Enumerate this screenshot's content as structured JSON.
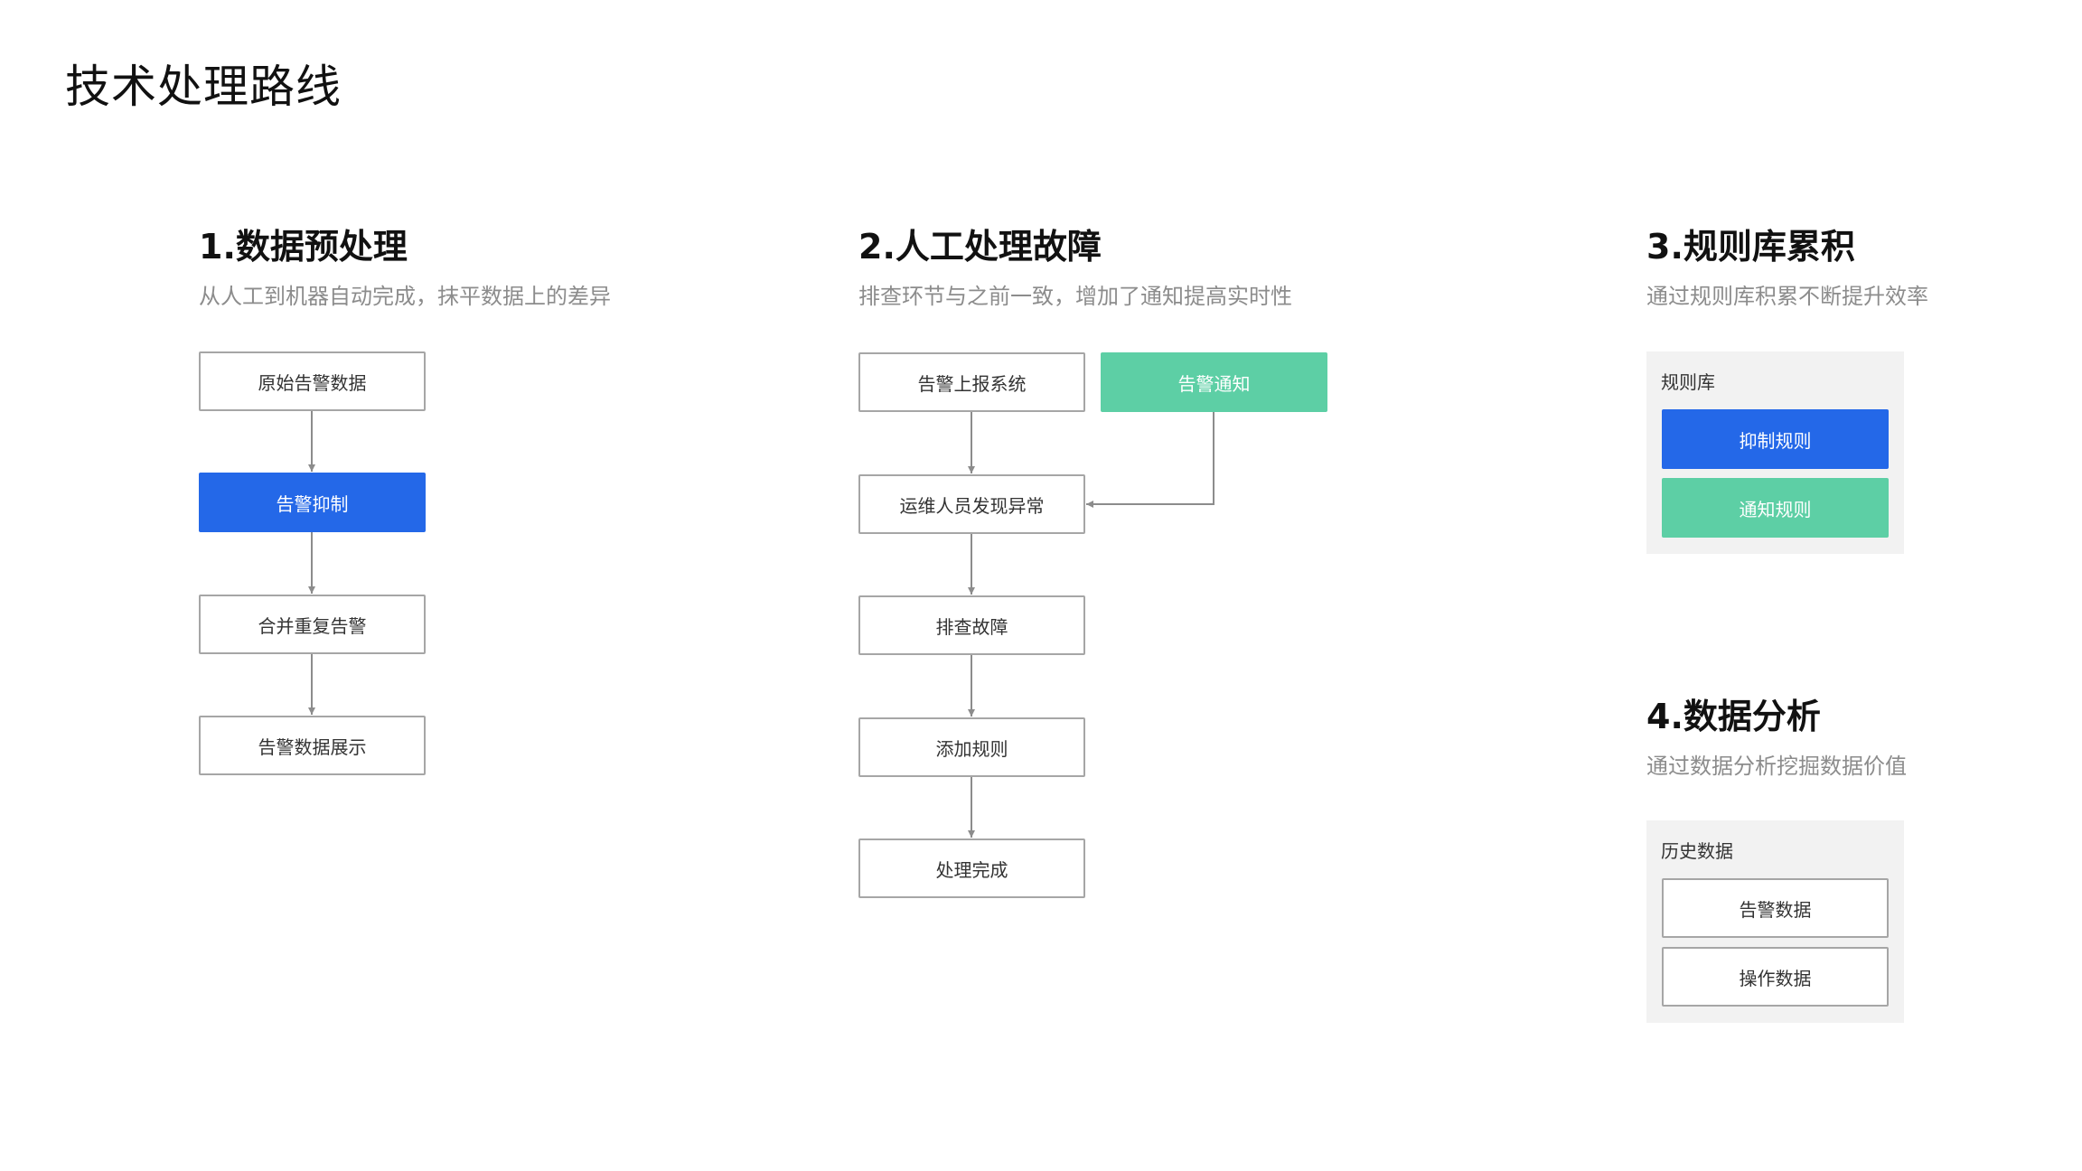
{
  "page_title": "技术处理路线",
  "sections": [
    {
      "title": "1.数据预处理",
      "subtitle": "从人工到机器自动完成，抹平数据上的差异",
      "nodes": [
        "原始告警数据",
        "告警抑制",
        "合并重复告警",
        "告警数据展示"
      ]
    },
    {
      "title": "2.人工处理故障",
      "subtitle": "排查环节与之前一致，增加了通知提高实时性",
      "nodes": [
        "告警上报系统",
        "运维人员发现异常",
        "排查故障",
        "添加规则",
        "处理完成"
      ],
      "side_node": "告警通知"
    },
    {
      "title": "3.规则库累积",
      "subtitle": "通过规则库积累不断提升效率",
      "panel_label": "规则库",
      "items": [
        "抑制规则",
        "通知规则"
      ]
    },
    {
      "title": "4.数据分析",
      "subtitle": "通过数据分析挖掘数据价值",
      "panel_label": "历史数据",
      "items": [
        "告警数据",
        "操作数据"
      ]
    }
  ],
  "colors": {
    "blue": "#2468e8",
    "green": "#5dcfa5",
    "border": "#a6a6a6",
    "panel": "#f2f2f2",
    "connector": "#8c8c8c"
  }
}
